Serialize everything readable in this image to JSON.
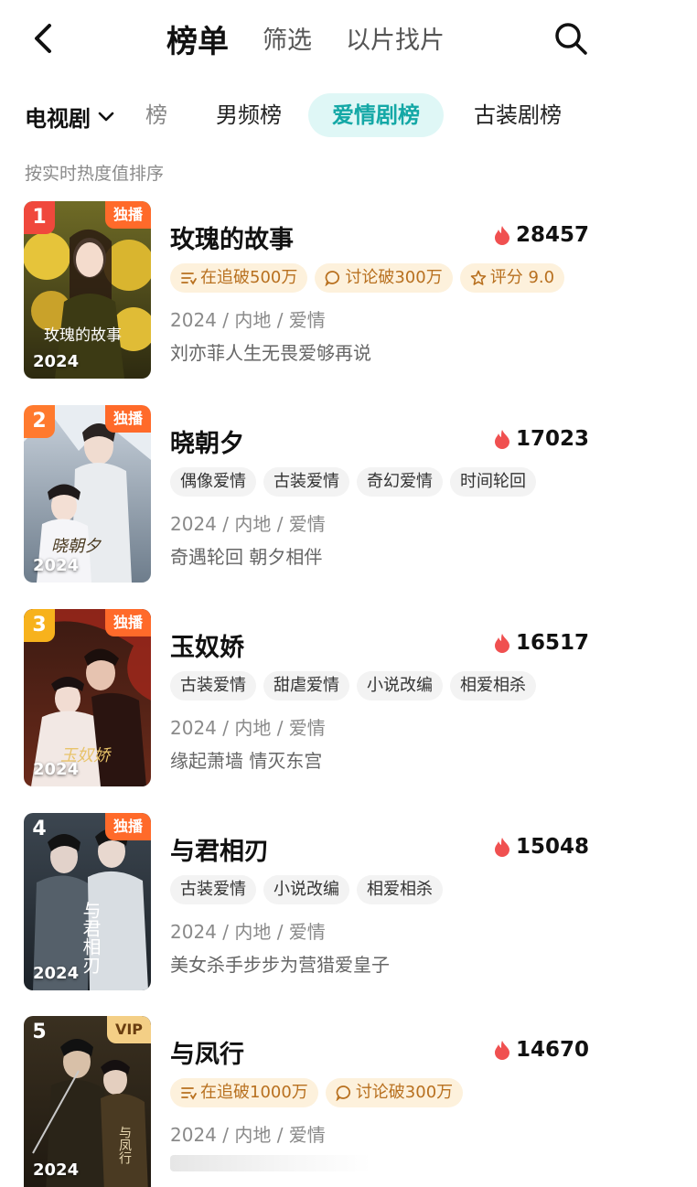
{
  "nav": {
    "tabs": [
      {
        "label": "榜单",
        "active": true
      },
      {
        "label": "筛选",
        "active": false
      },
      {
        "label": "以片找片",
        "active": false
      }
    ]
  },
  "category": {
    "selected": "电视剧",
    "chips": [
      "榜",
      "男频榜",
      "爱情剧榜",
      "古装剧榜"
    ],
    "active_chip": "爱情剧榜"
  },
  "sort_note": "按实时热度值排序",
  "colors": {
    "accent": "#14a8a6",
    "heat": "#f05050",
    "gold_tag_text": "#b8701f",
    "rank1": "#f0483c",
    "rank2": "#ff7a2e",
    "rank3": "#f7b21c"
  },
  "items": [
    {
      "rank": "1",
      "badge": "独播",
      "badge_type": "exclusive",
      "year": "2024",
      "title": "玫瑰的故事",
      "heat": "28457",
      "tags": [
        {
          "icon": "follow-icon",
          "text": "在追破500万",
          "style": "gold"
        },
        {
          "icon": "comment-icon",
          "text": "讨论破300万",
          "style": "gold"
        },
        {
          "icon": "star-icon",
          "text": "评分 9.0",
          "style": "gold"
        }
      ],
      "meta": "2024 / 内地 / 爱情",
      "desc": "刘亦菲人生无畏爱够再说",
      "poster_text": "玫瑰的故事"
    },
    {
      "rank": "2",
      "badge": "独播",
      "badge_type": "exclusive",
      "year": "2024",
      "title": "晓朝夕",
      "heat": "17023",
      "tags": [
        {
          "text": "偶像爱情",
          "style": "plain"
        },
        {
          "text": "古装爱情",
          "style": "plain"
        },
        {
          "text": "奇幻爱情",
          "style": "plain"
        },
        {
          "text": "时间轮回",
          "style": "plain"
        }
      ],
      "meta": "2024 / 内地 / 爱情",
      "desc": "奇遇轮回 朝夕相伴",
      "poster_text": "晓朝夕"
    },
    {
      "rank": "3",
      "badge": "独播",
      "badge_type": "exclusive",
      "year": "2024",
      "title": "玉奴娇",
      "heat": "16517",
      "tags": [
        {
          "text": "古装爱情",
          "style": "plain"
        },
        {
          "text": "甜虐爱情",
          "style": "plain"
        },
        {
          "text": "小说改编",
          "style": "plain"
        },
        {
          "text": "相爱相杀",
          "style": "plain"
        }
      ],
      "meta": "2024 / 内地 / 爱情",
      "desc": "缘起萧墙 情灭东宫",
      "poster_text": "玉奴娇"
    },
    {
      "rank": "4",
      "badge": "独播",
      "badge_type": "exclusive",
      "year": "2024",
      "title": "与君相刃",
      "heat": "15048",
      "tags": [
        {
          "text": "古装爱情",
          "style": "plain"
        },
        {
          "text": "小说改编",
          "style": "plain"
        },
        {
          "text": "相爱相杀",
          "style": "plain"
        }
      ],
      "meta": "2024 / 内地 / 爱情",
      "desc": "美女杀手步步为营猎爱皇子",
      "poster_text": "与君相刃"
    },
    {
      "rank": "5",
      "badge": "VIP",
      "badge_type": "vip",
      "year": "2024",
      "title": "与凤行",
      "heat": "14670",
      "tags": [
        {
          "icon": "follow-icon",
          "text": "在追破1000万",
          "style": "gold"
        },
        {
          "icon": "comment-icon",
          "text": "讨论破300万",
          "style": "gold"
        }
      ],
      "meta": "2024 / 内地 / 爱情",
      "desc": "",
      "poster_text": "与凤行"
    }
  ]
}
